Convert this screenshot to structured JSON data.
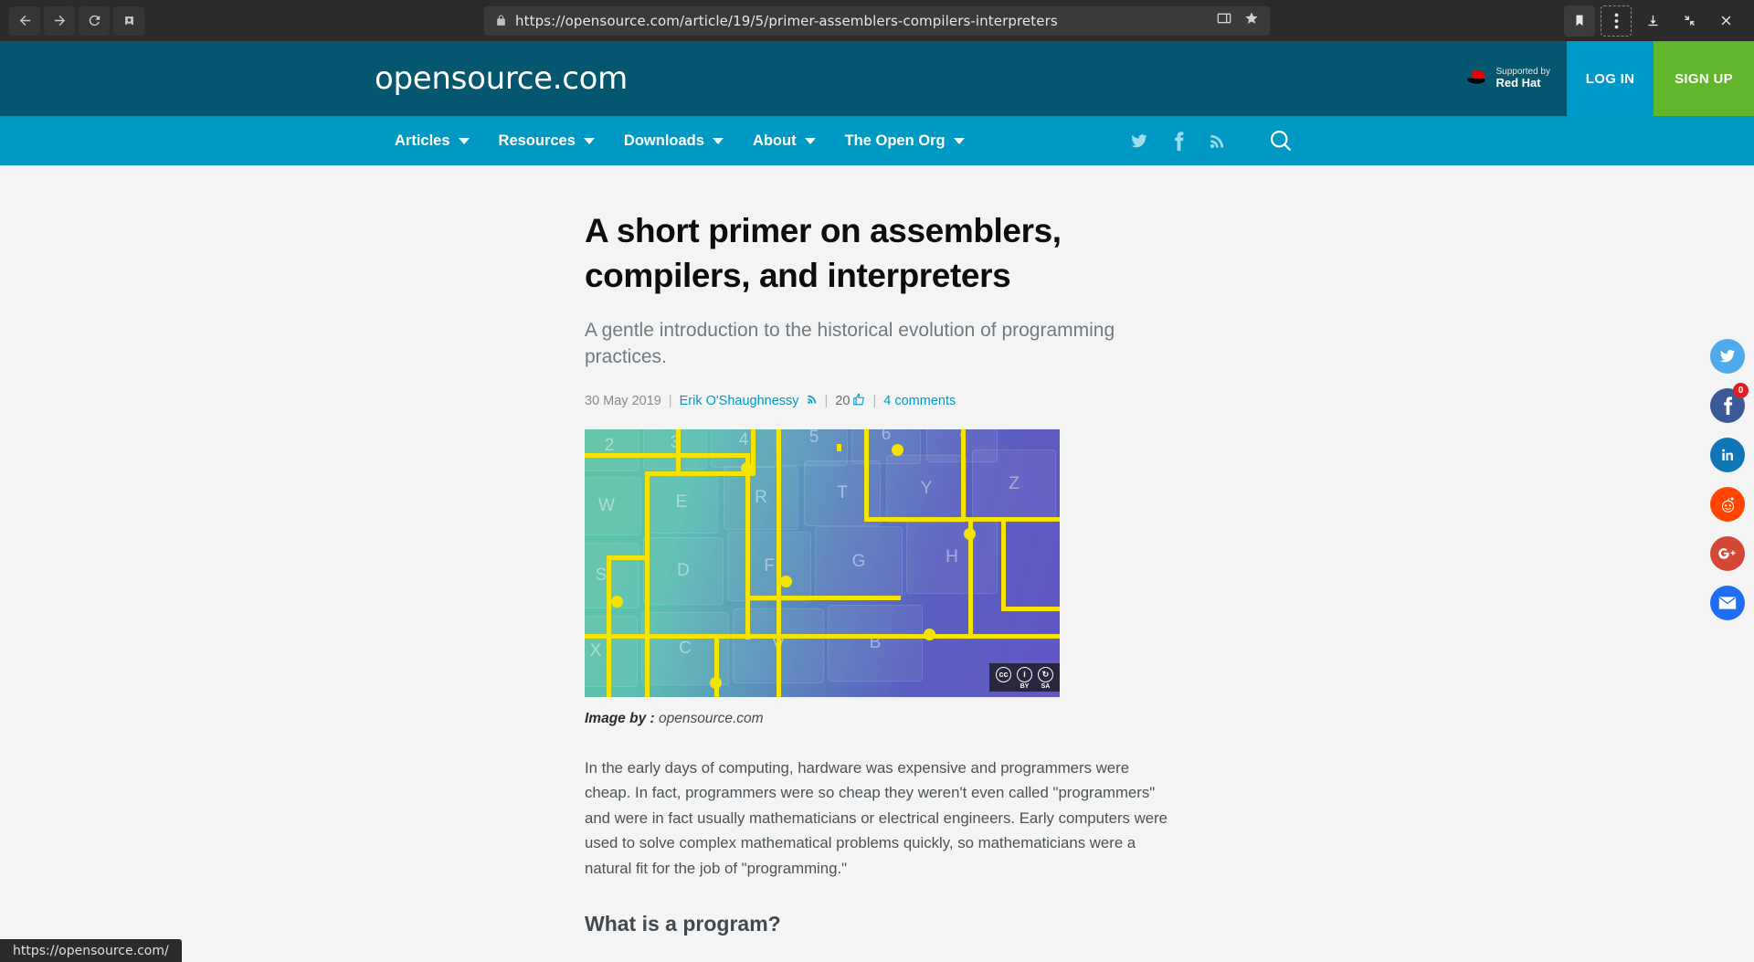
{
  "browser": {
    "back_label": "Back",
    "forward_label": "Forward",
    "reload_label": "Reload",
    "home_label": "Home",
    "url": "https://opensource.com/article/19/5/primer-assemblers-compilers-interpreters",
    "lock_icon": "lock-icon",
    "reader_icon": "reader-view-icon",
    "bookmark_star_icon": "star-icon",
    "bookmark_icon": "bookmark-icon",
    "menu_icon": "kebab-menu-icon",
    "download_icon": "download-icon",
    "minimize_icon": "collapse-icon",
    "close_icon": "close-icon",
    "status_url": "https://opensource.com/"
  },
  "header": {
    "logo": "opensource.com",
    "sponsor_line1": "Supported by",
    "sponsor_line2": "Red Hat",
    "sponsor_icon": "red-hat-logo-icon",
    "login_label": "LOG IN",
    "signup_label": "SIGN UP",
    "colors": {
      "header_bg": "#05566f",
      "nav_bg": "#0099c4",
      "login_bg": "#0099ca",
      "signup_bg": "#61b62c"
    }
  },
  "nav": {
    "items": [
      {
        "label": "Articles",
        "has_caret": true
      },
      {
        "label": "Resources",
        "has_caret": true
      },
      {
        "label": "Downloads",
        "has_caret": true
      },
      {
        "label": "About",
        "has_caret": true
      },
      {
        "label": "The Open Org",
        "has_caret": true
      }
    ],
    "social": [
      {
        "name": "twitter-icon"
      },
      {
        "name": "facebook-icon"
      },
      {
        "name": "rss-icon"
      }
    ],
    "search_icon": "search-icon"
  },
  "article": {
    "title": "A short primer on assemblers, compilers, and interpreters",
    "subtitle": "A gentle introduction to the historical evolution of programming practices.",
    "date": "30 May 2019",
    "author": "Erik O'Shaughnessy",
    "author_rss_icon": "rss-icon",
    "likes": "20",
    "like_icon": "thumbs-up-icon",
    "comments": "4 comments",
    "separator": "|",
    "image_caption_label": "Image by :",
    "image_caption_source": "opensource.com",
    "license": {
      "cc": "cc",
      "by": "BY",
      "sa": "SA"
    },
    "paragraph": "In the early days of computing, hardware was expensive and programmers were cheap. In fact, programmers were so cheap they weren't even called \"programmers\" and were in fact usually mathematicians or electrical engineers. Early computers were used to solve complex mathematical problems quickly, so mathematicians were a natural fit for the job of \"programming.\"",
    "section_heading": "What is a program?",
    "hero_keys": [
      "2",
      "3",
      "4",
      "5",
      "6",
      "W",
      "E",
      "R",
      "T",
      "Y",
      "Z",
      "S",
      "D",
      "F",
      "G",
      "X",
      "C",
      "V"
    ]
  },
  "share_rail": {
    "items": [
      {
        "name": "twitter-share",
        "icon": "twitter-icon",
        "color": "#4eaaea",
        "badge": ""
      },
      {
        "name": "facebook-share",
        "icon": "facebook-icon",
        "color": "#3b5998",
        "badge": "0"
      },
      {
        "name": "linkedin-share",
        "icon": "linkedin-icon",
        "color": "#1176b5",
        "badge": ""
      },
      {
        "name": "reddit-share",
        "icon": "reddit-icon",
        "color": "#ff4500",
        "badge": ""
      },
      {
        "name": "googleplus-share",
        "icon": "google-plus-icon",
        "color": "#d34836",
        "badge": ""
      },
      {
        "name": "email-share",
        "icon": "email-icon",
        "color": "#1f6df0",
        "badge": ""
      }
    ]
  }
}
